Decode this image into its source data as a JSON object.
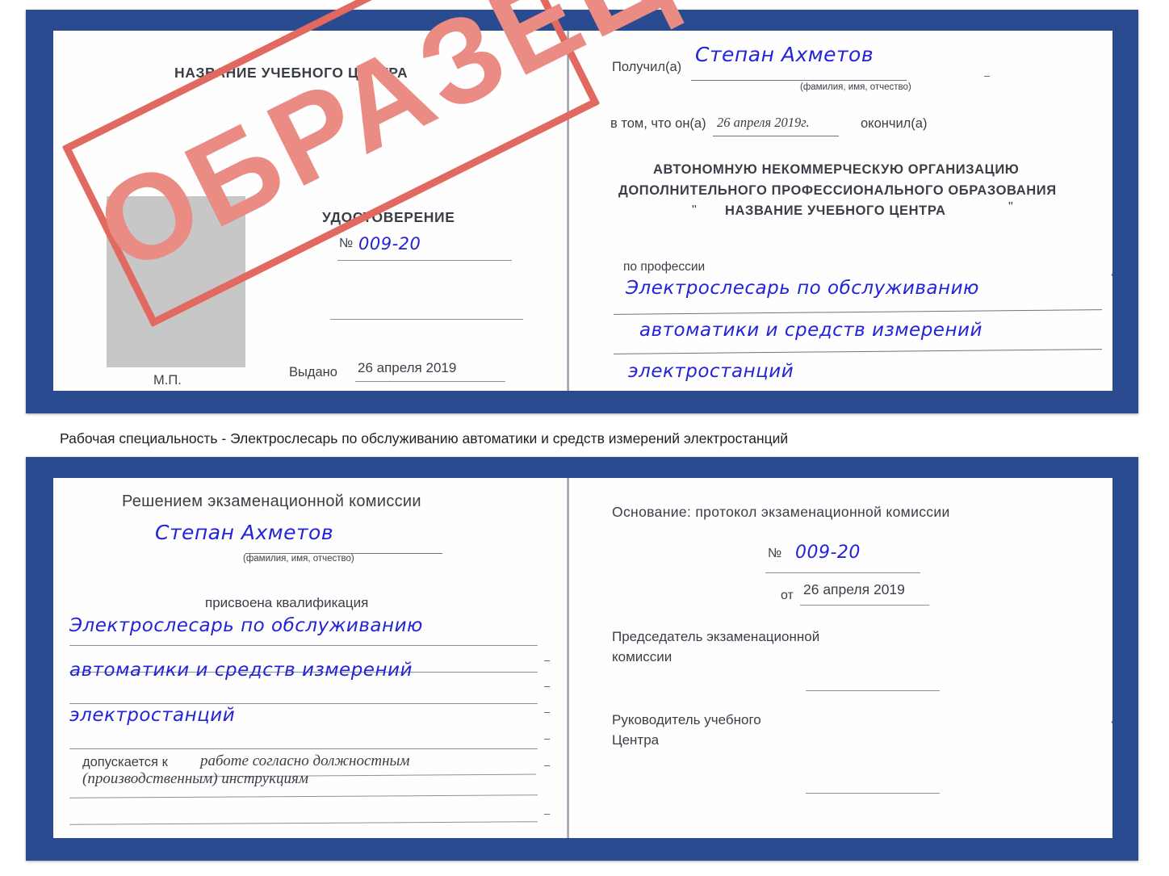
{
  "page": {
    "caption": "Рабочая специальность - Электрослесарь по обслуживанию автоматики и средств измерений электростанций",
    "stamp_text": "ОБРАЗЕЦ",
    "colors": {
      "cover_blue": "#2b4b91",
      "handwriting_blue": "#2323d8",
      "stamp_red": "#e2695f",
      "stamp_fill": "#ea8b84",
      "paper": "#fefefe",
      "photo_placeholder": "#c7c7c7",
      "rule_gray": "#8b9199"
    }
  },
  "certificate_top": {
    "left_page": {
      "center_name": "НАЗВАНИЕ УЧЕБНОГО ЦЕНТРА",
      "doc_type": "УДОСТОВЕРЕНИЕ",
      "number_label": "№",
      "number_value": "009-20",
      "issued_label": "Выдано",
      "issued_value": "26 апреля 2019",
      "seal_label": "М.П."
    },
    "right_page": {
      "received_label": "Получил(а)",
      "received_value": "Степан Ахметов",
      "fio_hint": "(фамилия, имя, отчество)",
      "that_he_label": "в том, что он(а)",
      "that_he_value": "26 апреля 2019г.",
      "finished_label": "окончил(а)",
      "org_line1": "АВТОНОМНУЮ НЕКОММЕРЧЕСКУЮ ОРГАНИЗАЦИЮ",
      "org_line2": "ДОПОЛНИТЕЛЬНОГО ПРОФЕССИОНАЛЬНОГО ОБРАЗОВАНИЯ",
      "org_quote_open": "\"",
      "org_line3": "НАЗВАНИЕ УЧЕБНОГО ЦЕНТРА",
      "org_quote_close": "\"",
      "profession_label": "по профессии",
      "profession_line1": "Электрослесарь по обслуживанию",
      "profession_line2": "автоматики и средств измерений",
      "profession_line3": "электростанций",
      "edge_marks": [
        "–",
        "–",
        "–",
        "и",
        "а",
        "‹-",
        "–",
        "–",
        "–"
      ]
    }
  },
  "certificate_bottom": {
    "left_page": {
      "heading": "Решением экзаменационной комиссии",
      "name_value": "Степан Ахметов",
      "fio_hint": "(фамилия, имя, отчество)",
      "qualification_label": "присвоена квалификация",
      "qualification_line1": "Электрослесарь по обслуживанию",
      "qualification_line2": "автоматики и средств измерений",
      "qualification_line3": "электростанций",
      "allowed_label": "допускается к",
      "allowed_value_line1": "работе согласно должностным",
      "allowed_value_line2": "(производственным) инструкциям"
    },
    "right_page": {
      "basis_label": "Основание: протокол экзаменационной комиссии",
      "number_label": "№",
      "number_value": "009-20",
      "from_label": "от",
      "from_value": "26 апреля 2019",
      "chairman_line1": "Председатель экзаменационной",
      "chairman_line2": "комиссии",
      "head_line1": "Руководитель учебного",
      "head_line2": "Центра",
      "edge_marks": [
        "–",
        "–",
        "–",
        "и",
        "а",
        "‹-",
        "–",
        "–",
        "–"
      ]
    }
  }
}
